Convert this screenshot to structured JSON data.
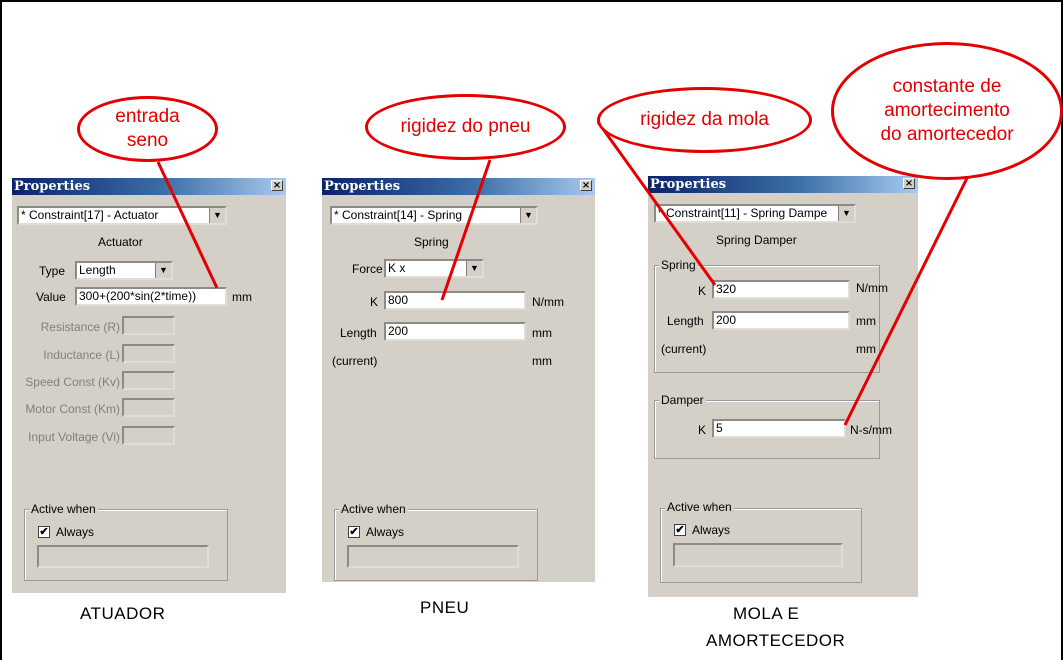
{
  "actuator_panel": {
    "title": "Properties",
    "close_glyph": "×",
    "constraint_select": "* Constraint[17] - Actuator",
    "dropdown_glyph": "▼",
    "heading": "Actuator",
    "type_label": "Type",
    "type_value": "Length",
    "value_label": "Value",
    "value_input": "300+(200*sin(2*time))",
    "value_unit": "mm",
    "disabled_fields": [
      "Resistance (R)",
      "Inductance (L)",
      "Speed Const (Kv)",
      "Motor Const (Km)",
      "Input Voltage (Vi)"
    ],
    "active_group": "Active when",
    "always_label": "Always",
    "always_checked": "✔",
    "caption": "ATUADOR"
  },
  "spring_panel": {
    "title": "Properties",
    "close_glyph": "×",
    "constraint_select": "* Constraint[14] - Spring",
    "dropdown_glyph": "▼",
    "heading": "Spring",
    "force_label": "Force",
    "force_value": "K x",
    "k_label": "K",
    "k_value": "800",
    "k_unit": "N/mm",
    "length_label": "Length",
    "length_value": "200",
    "length_unit": "mm",
    "current_label": "(current)",
    "current_unit": "mm",
    "active_group": "Active when",
    "always_label": "Always",
    "always_checked": "✔",
    "caption": "PNEU"
  },
  "damper_panel": {
    "title": "Properties",
    "close_glyph": "×",
    "constraint_select": "* Constraint[11] - Spring Dampe",
    "dropdown_glyph": "▼",
    "heading": "Spring Damper",
    "spring_group": "Spring",
    "k_label": "K",
    "k_value": "320",
    "k_unit": "N/mm",
    "length_label": "Length",
    "length_value": "200",
    "length_unit": "mm",
    "current_label": "(current)",
    "current_unit": "mm",
    "damper_group": "Damper",
    "damper_k_label": "K",
    "damper_k_value": "5",
    "damper_k_unit": "N-s/mm",
    "active_group": "Active when",
    "always_label": "Always",
    "always_checked": "✔",
    "caption_line1": "MOLA E",
    "caption_line2": "AMORTECEDOR"
  },
  "callouts": {
    "entrada": "entrada\nseno",
    "rigidez_pneu": "rigidez do pneu",
    "rigidez_mola": "rigidez da mola",
    "amortecimento": "constante de\namortecimento\ndo amortecedor"
  },
  "colors": {
    "annotation": "#e30000",
    "panel": "#d4d0c8",
    "titlebar": "#0a246a"
  }
}
